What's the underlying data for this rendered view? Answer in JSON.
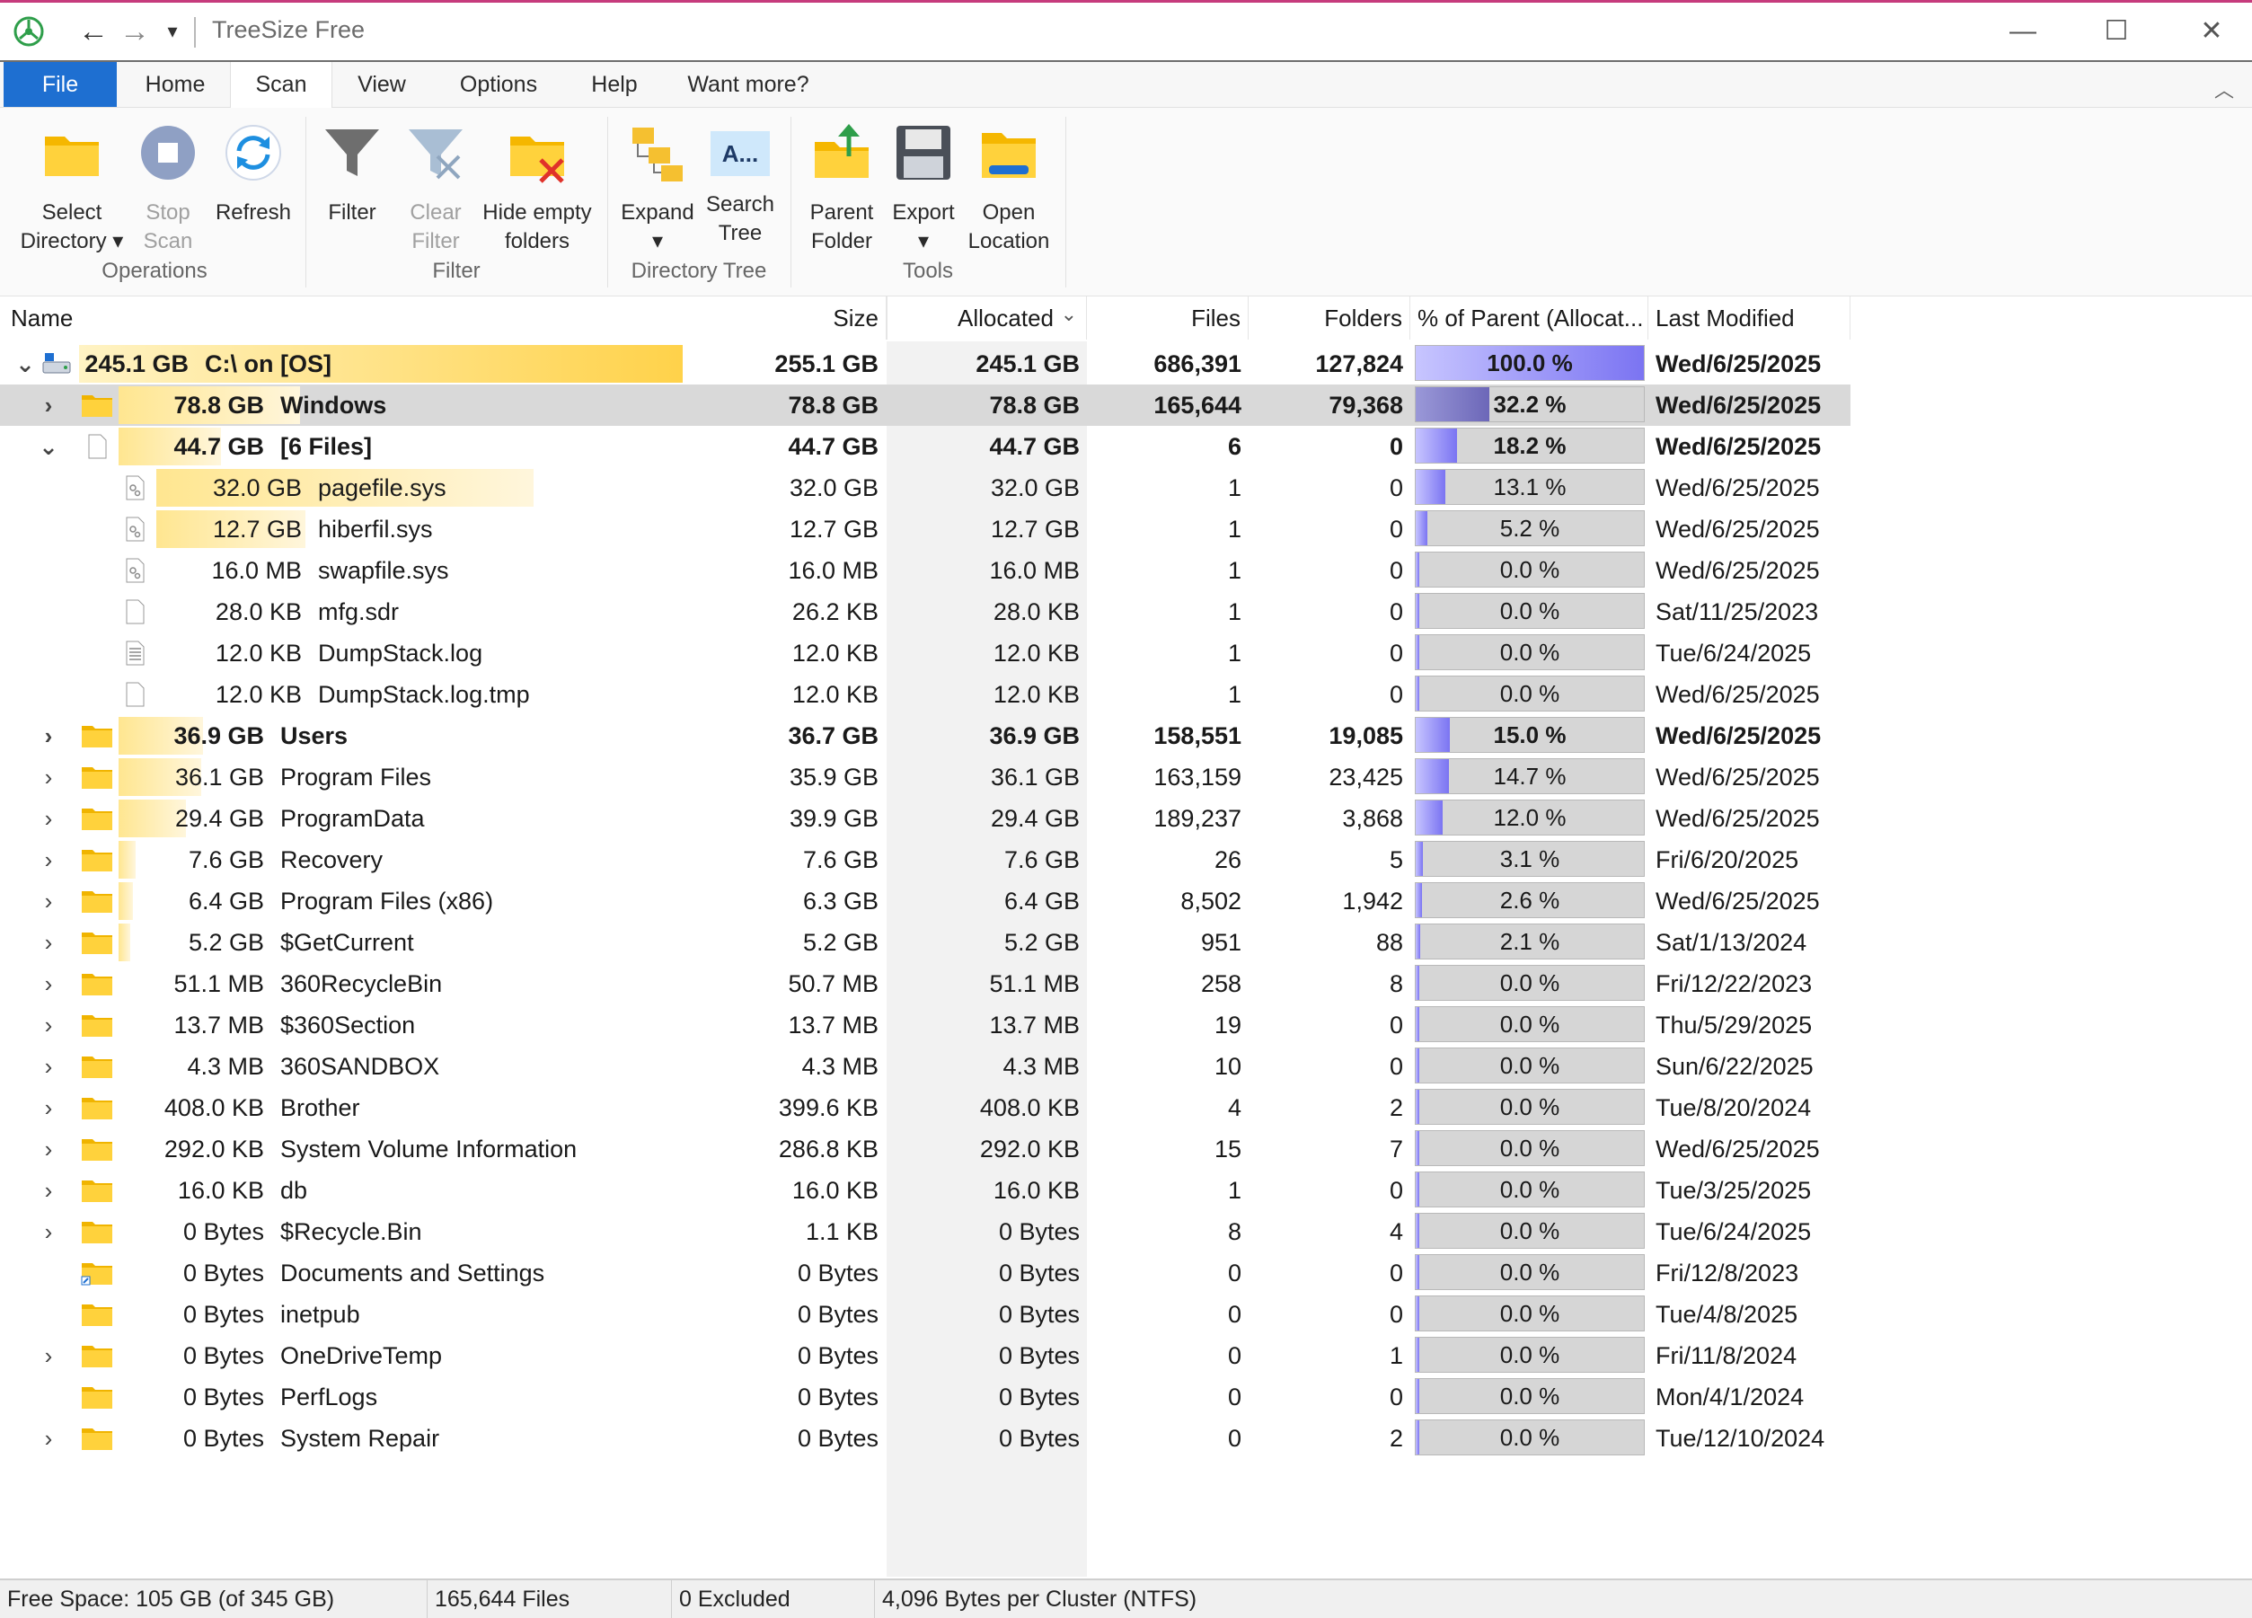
{
  "window": {
    "title": "TreeSize Free",
    "qat_dropdown": "▾",
    "minimize": "—",
    "maximize": "☐",
    "close": "✕"
  },
  "menu": {
    "tabs": [
      "File",
      "Home",
      "Scan",
      "View",
      "Options",
      "Help",
      "Want more?"
    ],
    "active_tab": "Scan",
    "collapse_icon": "︿"
  },
  "ribbon": {
    "operations": {
      "group_label": "Operations",
      "select_directory": [
        "Select",
        "Directory ▾"
      ],
      "stop_scan": [
        "Stop",
        "Scan"
      ],
      "refresh": "Refresh"
    },
    "filter": {
      "group_label": "Filter",
      "filter": "Filter",
      "clear_filter": [
        "Clear",
        "Filter"
      ],
      "hide_empty": [
        "Hide empty",
        "folders"
      ]
    },
    "directory_tree": {
      "group_label": "Directory Tree",
      "expand": [
        "Expand",
        "▾"
      ],
      "search_tree": [
        "Search",
        "Tree"
      ],
      "search_icon_text": "A..."
    },
    "tools": {
      "group_label": "Tools",
      "parent_folder": [
        "Parent",
        "Folder"
      ],
      "export": [
        "Export",
        "▾"
      ],
      "open_location": [
        "Open",
        "Location"
      ]
    }
  },
  "columns": {
    "name": "Name",
    "size": "Size",
    "allocated": "Allocated",
    "allocated_sort": "⌄",
    "files": "Files",
    "folders": "Folders",
    "pct": "% of Parent (Allocat...",
    "last_modified": "Last Modified"
  },
  "rows": [
    {
      "level": 0,
      "expander": "⌄",
      "icon": "drive-icon",
      "tree_size": "245.1 GB",
      "name": "C:\\  on  [OS]",
      "size": "255.1 GB",
      "allocated": "245.1 GB",
      "files": "686,391",
      "folders": "127,824",
      "pct": 100.0,
      "pct_text": "100.0 %",
      "modified": "Wed/6/25/2025",
      "bold": true,
      "selected": false,
      "bar": 1.0
    },
    {
      "level": 1,
      "expander": "›",
      "icon": "folder-icon",
      "tree_size": "78.8 GB",
      "name": "Windows",
      "size": "78.8 GB",
      "allocated": "78.8 GB",
      "files": "165,644",
      "folders": "79,368",
      "pct": 32.2,
      "pct_text": "32.2 %",
      "modified": "Wed/6/25/2025",
      "bold": true,
      "selected": true,
      "bar": 0.322
    },
    {
      "level": 1,
      "expander": "⌄",
      "icon": "file-icon",
      "tree_size": "44.7 GB",
      "name": "[6 Files]",
      "size": "44.7 GB",
      "allocated": "44.7 GB",
      "files": "6",
      "folders": "0",
      "pct": 18.2,
      "pct_text": "18.2 %",
      "modified": "Wed/6/25/2025",
      "bold": true,
      "selected": false,
      "bar": 0.182
    },
    {
      "level": 2,
      "expander": "",
      "icon": "system-file-icon",
      "tree_size": "32.0 GB",
      "name": "pagefile.sys",
      "size": "32.0 GB",
      "allocated": "32.0 GB",
      "files": "1",
      "folders": "0",
      "pct": 13.1,
      "pct_text": "13.1 %",
      "modified": "Wed/6/25/2025",
      "bold": false,
      "selected": false,
      "bar": 0.716
    },
    {
      "level": 2,
      "expander": "",
      "icon": "system-file-icon",
      "tree_size": "12.7 GB",
      "name": "hiberfil.sys",
      "size": "12.7 GB",
      "allocated": "12.7 GB",
      "files": "1",
      "folders": "0",
      "pct": 5.2,
      "pct_text": "5.2 %",
      "modified": "Wed/6/25/2025",
      "bold": false,
      "selected": false,
      "bar": 0.284
    },
    {
      "level": 2,
      "expander": "",
      "icon": "system-file-icon",
      "tree_size": "16.0 MB",
      "name": "swapfile.sys",
      "size": "16.0 MB",
      "allocated": "16.0 MB",
      "files": "1",
      "folders": "0",
      "pct": 0.0,
      "pct_text": "0.0 %",
      "modified": "Wed/6/25/2025",
      "bold": false,
      "selected": false,
      "bar": 0
    },
    {
      "level": 2,
      "expander": "",
      "icon": "file-icon",
      "tree_size": "28.0 KB",
      "name": "mfg.sdr",
      "size": "26.2 KB",
      "allocated": "28.0 KB",
      "files": "1",
      "folders": "0",
      "pct": 0.0,
      "pct_text": "0.0 %",
      "modified": "Sat/11/25/2023",
      "bold": false,
      "selected": false,
      "bar": 0
    },
    {
      "level": 2,
      "expander": "",
      "icon": "text-file-icon",
      "tree_size": "12.0 KB",
      "name": "DumpStack.log",
      "size": "12.0 KB",
      "allocated": "12.0 KB",
      "files": "1",
      "folders": "0",
      "pct": 0.0,
      "pct_text": "0.0 %",
      "modified": "Tue/6/24/2025",
      "bold": false,
      "selected": false,
      "bar": 0
    },
    {
      "level": 2,
      "expander": "",
      "icon": "file-icon",
      "tree_size": "12.0 KB",
      "name": "DumpStack.log.tmp",
      "size": "12.0 KB",
      "allocated": "12.0 KB",
      "files": "1",
      "folders": "0",
      "pct": 0.0,
      "pct_text": "0.0 %",
      "modified": "Wed/6/25/2025",
      "bold": false,
      "selected": false,
      "bar": 0
    },
    {
      "level": 1,
      "expander": "›",
      "icon": "folder-icon",
      "tree_size": "36.9 GB",
      "name": "Users",
      "size": "36.7 GB",
      "allocated": "36.9 GB",
      "files": "158,551",
      "folders": "19,085",
      "pct": 15.0,
      "pct_text": "15.0 %",
      "modified": "Wed/6/25/2025",
      "bold": true,
      "selected": false,
      "bar": 0.15
    },
    {
      "level": 1,
      "expander": "›",
      "icon": "folder-icon",
      "tree_size": "36.1 GB",
      "name": "Program Files",
      "size": "35.9 GB",
      "allocated": "36.1 GB",
      "files": "163,159",
      "folders": "23,425",
      "pct": 14.7,
      "pct_text": "14.7 %",
      "modified": "Wed/6/25/2025",
      "bold": false,
      "selected": false,
      "bar": 0.147
    },
    {
      "level": 1,
      "expander": "›",
      "icon": "folder-icon",
      "tree_size": "29.4 GB",
      "name": "ProgramData",
      "size": "39.9 GB",
      "allocated": "29.4 GB",
      "files": "189,237",
      "folders": "3,868",
      "pct": 12.0,
      "pct_text": "12.0 %",
      "modified": "Wed/6/25/2025",
      "bold": false,
      "selected": false,
      "bar": 0.12
    },
    {
      "level": 1,
      "expander": "›",
      "icon": "folder-icon",
      "tree_size": "7.6 GB",
      "name": "Recovery",
      "size": "7.6 GB",
      "allocated": "7.6 GB",
      "files": "26",
      "folders": "5",
      "pct": 3.1,
      "pct_text": "3.1 %",
      "modified": "Fri/6/20/2025",
      "bold": false,
      "selected": false,
      "bar": 0.031
    },
    {
      "level": 1,
      "expander": "›",
      "icon": "folder-icon",
      "tree_size": "6.4 GB",
      "name": "Program Files (x86)",
      "size": "6.3 GB",
      "allocated": "6.4 GB",
      "files": "8,502",
      "folders": "1,942",
      "pct": 2.6,
      "pct_text": "2.6 %",
      "modified": "Wed/6/25/2025",
      "bold": false,
      "selected": false,
      "bar": 0.026
    },
    {
      "level": 1,
      "expander": "›",
      "icon": "folder-icon",
      "tree_size": "5.2 GB",
      "name": "$GetCurrent",
      "size": "5.2 GB",
      "allocated": "5.2 GB",
      "files": "951",
      "folders": "88",
      "pct": 2.1,
      "pct_text": "2.1 %",
      "modified": "Sat/1/13/2024",
      "bold": false,
      "selected": false,
      "bar": 0.021
    },
    {
      "level": 1,
      "expander": "›",
      "icon": "folder-icon",
      "tree_size": "51.1 MB",
      "name": "360RecycleBin",
      "size": "50.7 MB",
      "allocated": "51.1 MB",
      "files": "258",
      "folders": "8",
      "pct": 0.0,
      "pct_text": "0.0 %",
      "modified": "Fri/12/22/2023",
      "bold": false,
      "selected": false,
      "bar": 0
    },
    {
      "level": 1,
      "expander": "›",
      "icon": "folder-icon",
      "tree_size": "13.7 MB",
      "name": "$360Section",
      "size": "13.7 MB",
      "allocated": "13.7 MB",
      "files": "19",
      "folders": "0",
      "pct": 0.0,
      "pct_text": "0.0 %",
      "modified": "Thu/5/29/2025",
      "bold": false,
      "selected": false,
      "bar": 0
    },
    {
      "level": 1,
      "expander": "›",
      "icon": "folder-icon",
      "tree_size": "4.3 MB",
      "name": "360SANDBOX",
      "size": "4.3 MB",
      "allocated": "4.3 MB",
      "files": "10",
      "folders": "0",
      "pct": 0.0,
      "pct_text": "0.0 %",
      "modified": "Sun/6/22/2025",
      "bold": false,
      "selected": false,
      "bar": 0
    },
    {
      "level": 1,
      "expander": "›",
      "icon": "folder-icon",
      "tree_size": "408.0 KB",
      "name": "Brother",
      "size": "399.6 KB",
      "allocated": "408.0 KB",
      "files": "4",
      "folders": "2",
      "pct": 0.0,
      "pct_text": "0.0 %",
      "modified": "Tue/8/20/2024",
      "bold": false,
      "selected": false,
      "bar": 0
    },
    {
      "level": 1,
      "expander": "›",
      "icon": "folder-icon",
      "tree_size": "292.0 KB",
      "name": "System Volume Information",
      "size": "286.8 KB",
      "allocated": "292.0 KB",
      "files": "15",
      "folders": "7",
      "pct": 0.0,
      "pct_text": "0.0 %",
      "modified": "Wed/6/25/2025",
      "bold": false,
      "selected": false,
      "bar": 0
    },
    {
      "level": 1,
      "expander": "›",
      "icon": "folder-icon",
      "tree_size": "16.0 KB",
      "name": "db",
      "size": "16.0 KB",
      "allocated": "16.0 KB",
      "files": "1",
      "folders": "0",
      "pct": 0.0,
      "pct_text": "0.0 %",
      "modified": "Tue/3/25/2025",
      "bold": false,
      "selected": false,
      "bar": 0
    },
    {
      "level": 1,
      "expander": "›",
      "icon": "folder-icon",
      "tree_size": "0 Bytes",
      "name": "$Recycle.Bin",
      "size": "1.1 KB",
      "allocated": "0 Bytes",
      "files": "8",
      "folders": "4",
      "pct": 0.0,
      "pct_text": "0.0 %",
      "modified": "Tue/6/24/2025",
      "bold": false,
      "selected": false,
      "bar": 0
    },
    {
      "level": 1,
      "expander": "",
      "icon": "folder-shortcut-icon",
      "tree_size": "0 Bytes",
      "name": "Documents and Settings",
      "size": "0 Bytes",
      "allocated": "0 Bytes",
      "files": "0",
      "folders": "0",
      "pct": 0.0,
      "pct_text": "0.0 %",
      "modified": "Fri/12/8/2023",
      "bold": false,
      "selected": false,
      "bar": 0
    },
    {
      "level": 1,
      "expander": "",
      "icon": "folder-icon",
      "tree_size": "0 Bytes",
      "name": "inetpub",
      "size": "0 Bytes",
      "allocated": "0 Bytes",
      "files": "0",
      "folders": "0",
      "pct": 0.0,
      "pct_text": "0.0 %",
      "modified": "Tue/4/8/2025",
      "bold": false,
      "selected": false,
      "bar": 0
    },
    {
      "level": 1,
      "expander": "›",
      "icon": "folder-icon",
      "tree_size": "0 Bytes",
      "name": "OneDriveTemp",
      "size": "0 Bytes",
      "allocated": "0 Bytes",
      "files": "0",
      "folders": "1",
      "pct": 0.0,
      "pct_text": "0.0 %",
      "modified": "Fri/11/8/2024",
      "bold": false,
      "selected": false,
      "bar": 0
    },
    {
      "level": 1,
      "expander": "",
      "icon": "folder-icon",
      "tree_size": "0 Bytes",
      "name": "PerfLogs",
      "size": "0 Bytes",
      "allocated": "0 Bytes",
      "files": "0",
      "folders": "0",
      "pct": 0.0,
      "pct_text": "0.0 %",
      "modified": "Mon/4/1/2024",
      "bold": false,
      "selected": false,
      "bar": 0
    },
    {
      "level": 1,
      "expander": "›",
      "icon": "folder-icon",
      "tree_size": "0 Bytes",
      "name": "System Repair",
      "size": "0 Bytes",
      "allocated": "0 Bytes",
      "files": "0",
      "folders": "2",
      "pct": 0.0,
      "pct_text": "0.0 %",
      "modified": "Tue/12/10/2024",
      "bold": false,
      "selected": false,
      "bar": 0
    }
  ],
  "status": {
    "free_space": "Free Space: 105 GB  (of 345 GB)",
    "files": "165,644 Files",
    "excluded": "0 Excluded",
    "cluster": "4,096 Bytes per Cluster (NTFS)"
  },
  "colors": {
    "file_tab": "#1e6fd1",
    "size_bar": "#ffd24a",
    "pct_fill": "#7b74f2",
    "selected_row": "#d9d9d9"
  }
}
